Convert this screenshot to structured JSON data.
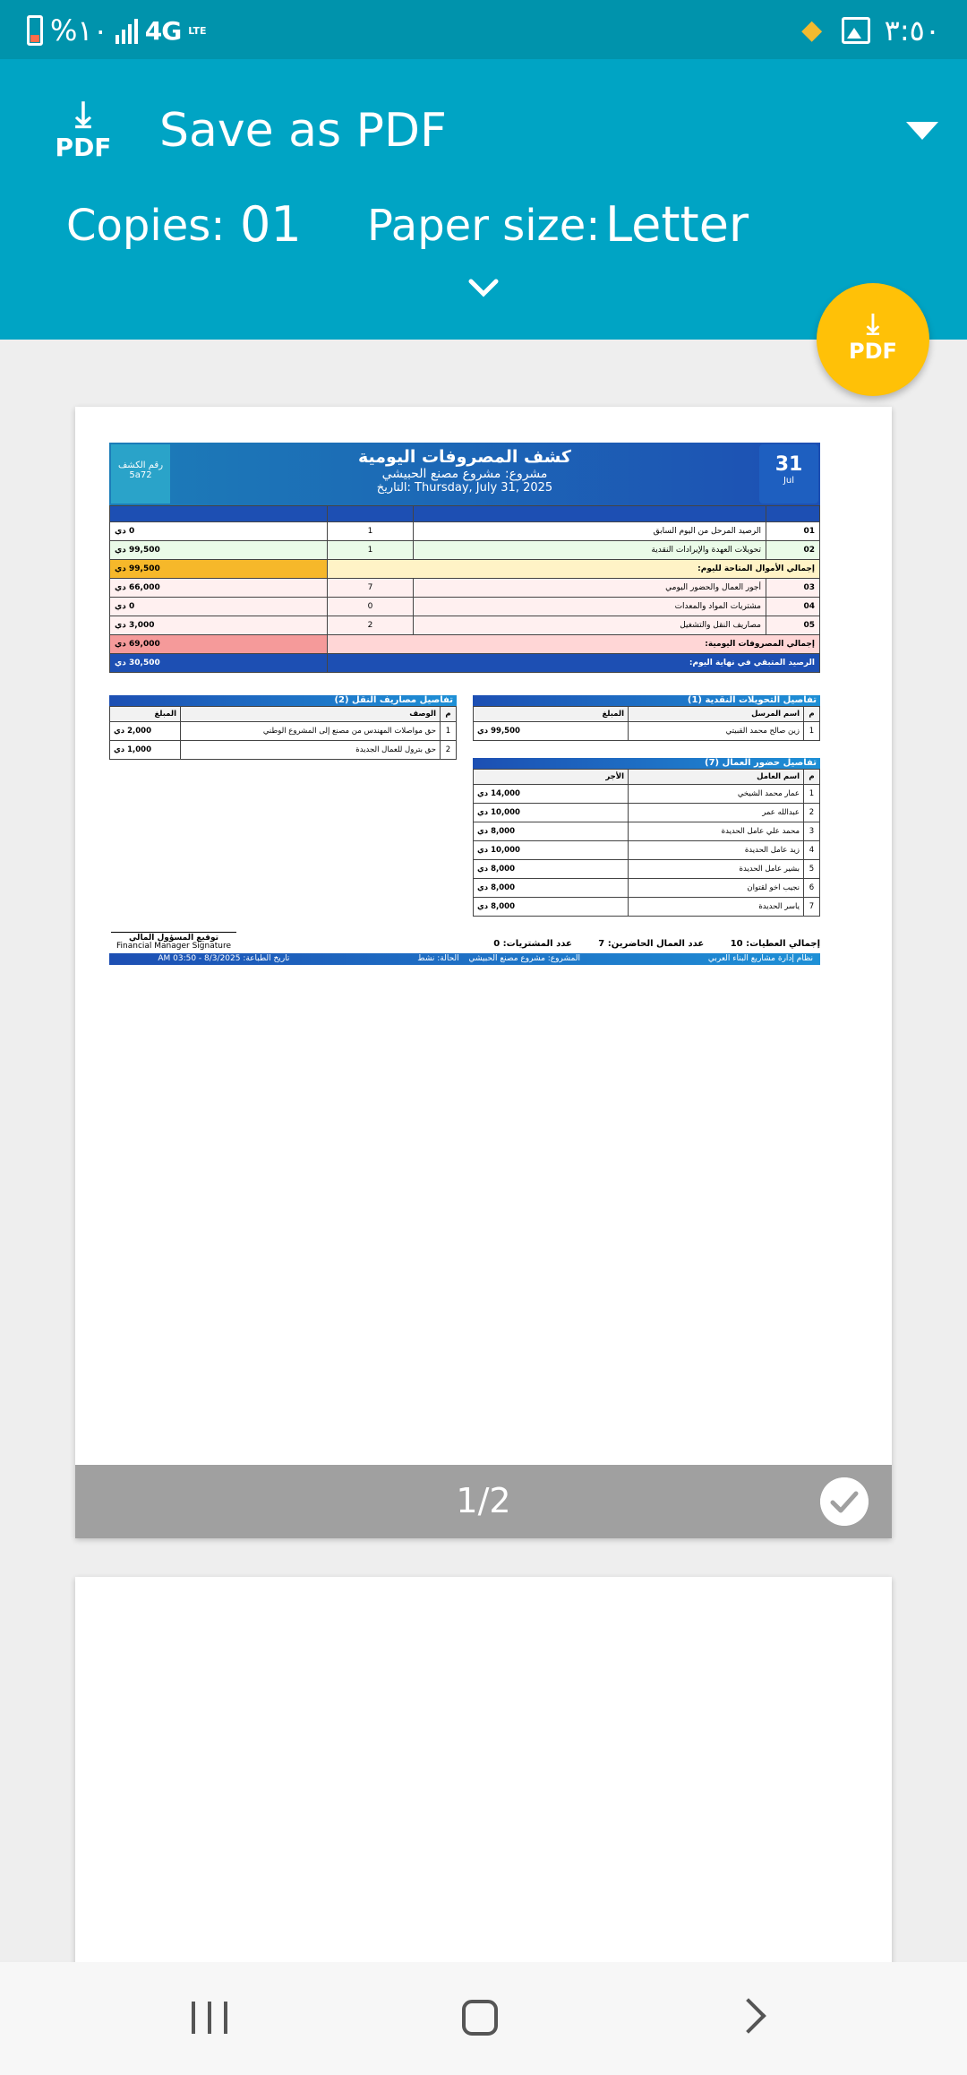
{
  "status_bar": {
    "battery_text": "%١٠",
    "network": "4G",
    "network_sub": "LTE",
    "time": "٣:٥٠"
  },
  "header": {
    "printer_name": "Save as PDF",
    "pdf_icon_label": "PDF",
    "copies_label": "Copies:",
    "copies_value": "01",
    "paper_label": "Paper size:",
    "paper_value": "Letter"
  },
  "fab": {
    "label": "PDF"
  },
  "preview": {
    "page_indicator": "1/2"
  },
  "document": {
    "title": "كشف المصروفات اليومية",
    "project": "مشروع: مشروع مصنع الحبيشي",
    "date_label": "التاريخ: Thursday, July 31, 2025",
    "sheet_no_label": "رقم الكشف",
    "sheet_no": "5a72",
    "day": "31",
    "month": "Jul",
    "summary_rows": [
      {
        "code": "01",
        "label": "الرصيد المرحل من اليوم السابق",
        "qty": "1",
        "amount": "0 دي",
        "style": "r-white"
      },
      {
        "code": "02",
        "label": "تحويلات العهدة والإيرادات النقدية",
        "qty": "1",
        "amount": "99,500 دي",
        "style": "r-green"
      },
      {
        "code": "",
        "label": "إجمالي الأموال المتاحة لليوم:",
        "qty": "",
        "amount": "99,500 دي",
        "style": "r-gold"
      },
      {
        "code": "03",
        "label": "أجور العمال والحضور اليومي",
        "qty": "7",
        "amount": "66,000 دي",
        "style": "r-pink"
      },
      {
        "code": "04",
        "label": "مشتريات المواد والمعدات",
        "qty": "0",
        "amount": "0 دي",
        "style": "r-pink"
      },
      {
        "code": "05",
        "label": "مصاريف النقل والتشغيل",
        "qty": "2",
        "amount": "3,000 دي",
        "style": "r-pink"
      },
      {
        "code": "",
        "label": "إجمالي المصروفات اليومية:",
        "qty": "",
        "amount": "69,000 دي",
        "style": "r-red"
      },
      {
        "code": "",
        "label": "الرصيد المتبقي في نهاية اليوم:",
        "qty": "",
        "amount": "30,500 دي",
        "style": "r-blue"
      }
    ],
    "transfers": {
      "title": "تفاصيل التحويلات النقدية (1)",
      "headers": [
        "م",
        "اسم المرسل",
        "المبلغ"
      ],
      "rows": [
        {
          "n": "1",
          "name": "زين صالح محمد القبيتي",
          "amount": "99,500 دي"
        }
      ]
    },
    "transport": {
      "title": "تفاصيل مصاريف النقل (2)",
      "headers": [
        "م",
        "الوصف",
        "المبلغ"
      ],
      "rows": [
        {
          "n": "1",
          "name": "حق مواصلات المهندس من مصنع إلى المشروع الوطني",
          "amount": "2,000 دي"
        },
        {
          "n": "2",
          "name": "حق بترول للعمال الجديدة",
          "amount": "1,000 دي"
        }
      ]
    },
    "workers": {
      "title": "تفاصيل حضور العمال (7)",
      "headers": [
        "م",
        "اسم العامل",
        "الأجر"
      ],
      "rows": [
        {
          "n": "1",
          "name": "عمار محمد الشيخي",
          "amount": "14,000 دي"
        },
        {
          "n": "2",
          "name": "عبدالله عمر",
          "amount": "10,000 دي"
        },
        {
          "n": "3",
          "name": "محمد علي عامل الحديدة",
          "amount": "8,000 دي"
        },
        {
          "n": "4",
          "name": "زيد عامل الحديدة",
          "amount": "10,000 دي"
        },
        {
          "n": "5",
          "name": "بشير عامل الحديدة",
          "amount": "8,000 دي"
        },
        {
          "n": "6",
          "name": "نجيب اخو لقتوان",
          "amount": "8,000 دي"
        },
        {
          "n": "7",
          "name": "ياسر الحديدة",
          "amount": "8,000 دي"
        }
      ]
    },
    "totals": {
      "transfers": "إجمالي العطيات: 10",
      "workers": "عدد العمال الحاضرين: 7",
      "purchases": "عدد المشتريات: 0"
    },
    "signature_ar": "توقيع المسؤول المالي",
    "signature_en": "Financial Manager Signature",
    "footer": {
      "system": "نظام إدارة مشاريع البناء العربي",
      "project": "المشروع: مشروع مصنع الحبيشي",
      "status": "الحالة: نشط",
      "printed": "تاريخ الطباعة: 8/3/2025 - 03:50 AM"
    }
  }
}
